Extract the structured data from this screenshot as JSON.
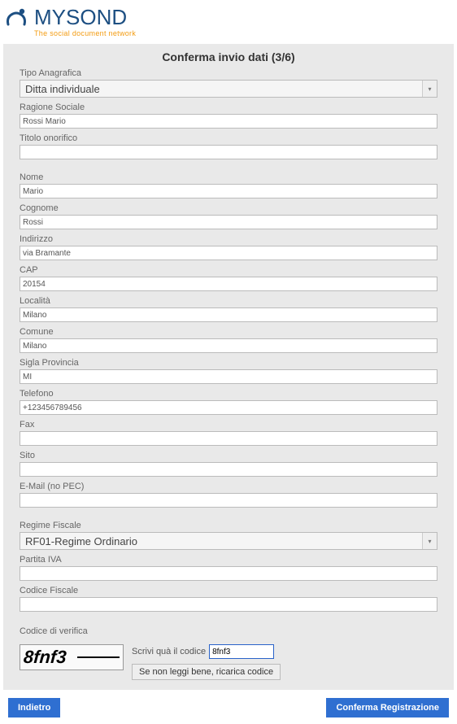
{
  "brand": {
    "my": "MY",
    "sond": "SOND",
    "tagline": "The social document network"
  },
  "page": {
    "title": "Conferma invio dati (3/6)"
  },
  "labels": {
    "tipo_anagrafica": "Tipo Anagrafica",
    "ragione_sociale": "Ragione Sociale",
    "titolo_onorifico": "Titolo onorifico",
    "nome": "Nome",
    "cognome": "Cognome",
    "indirizzo": "Indirizzo",
    "cap": "CAP",
    "localita": "Località",
    "comune": "Comune",
    "sigla_provincia": "Sigla Provincia",
    "telefono": "Telefono",
    "fax": "Fax",
    "sito": "Sito",
    "email": "E-Mail (no PEC)",
    "regime_fiscale": "Regime Fiscale",
    "partita_iva": "Partita IVA",
    "codice_fiscale": "Codice Fiscale",
    "codice_verifica": "Codice di verifica",
    "scrivi_codice": "Scrivi quà il codice",
    "reload_captcha": "Se non leggi bene, ricarica codice"
  },
  "values": {
    "tipo_anagrafica": "Ditta individuale",
    "ragione_sociale": "Rossi Mario",
    "titolo_onorifico": "",
    "nome": "Mario",
    "cognome": "Rossi",
    "indirizzo": "via Bramante",
    "cap": "20154",
    "localita": "Milano",
    "comune": "Milano",
    "sigla_provincia": "MI",
    "telefono": "+123456789456",
    "fax": "",
    "sito": "",
    "email": "",
    "regime_fiscale": "RF01-Regime Ordinario",
    "partita_iva": "",
    "codice_fiscale": "",
    "captcha_image_text": "8fnf3",
    "captcha_input": "8fnf3"
  },
  "buttons": {
    "back": "Indietro",
    "confirm": "Conferma Registrazione"
  }
}
